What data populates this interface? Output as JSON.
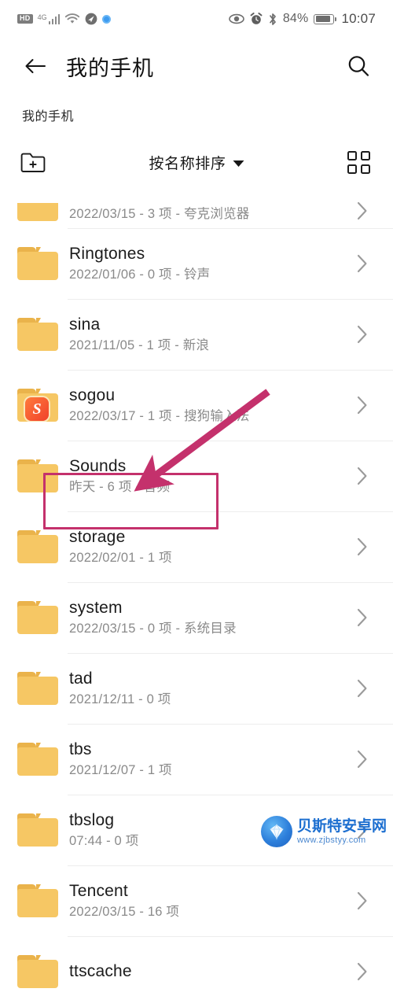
{
  "status_bar": {
    "hd_label": "HD",
    "network_label": "4G",
    "icons": [
      "hd-badge",
      "signal-bars",
      "wifi-icon",
      "location-icon",
      "blue-dot-icon"
    ],
    "right_icons": [
      "eye-icon",
      "alarm-icon",
      "bluetooth-icon"
    ],
    "battery_percent": "84%",
    "time": "10:07"
  },
  "header": {
    "title": "我的手机",
    "back_icon": "back-arrow-icon",
    "search_icon": "search-icon"
  },
  "breadcrumb": {
    "path": "我的手机"
  },
  "toolbar": {
    "new_folder_icon": "new-folder-icon",
    "sort_label": "按名称排序",
    "sort_caret": "chevron-down-icon",
    "grid_view_icon": "grid-view-icon"
  },
  "file_list": [
    {
      "name": "",
      "subtitle": "2022/03/15 - 3 项 - 夸克浏览器",
      "clipped": true,
      "badge": null
    },
    {
      "name": "Ringtones",
      "subtitle": "2022/01/06 - 0 项 - 铃声",
      "clipped": false,
      "badge": null
    },
    {
      "name": "sina",
      "subtitle": "2021/11/05 - 1 项 - 新浪",
      "clipped": false,
      "badge": null
    },
    {
      "name": "sogou",
      "subtitle": "2022/03/17 - 1 项 - 搜狗输入法",
      "clipped": false,
      "badge": "S"
    },
    {
      "name": "Sounds",
      "subtitle": "昨天 - 6 项 - 音频",
      "clipped": false,
      "badge": null
    },
    {
      "name": "storage",
      "subtitle": "2022/02/01 - 1 项",
      "clipped": false,
      "badge": null
    },
    {
      "name": "system",
      "subtitle": "2022/03/15 - 0 项 - 系统目录",
      "clipped": false,
      "badge": null
    },
    {
      "name": "tad",
      "subtitle": "2021/12/11 - 0 项",
      "clipped": false,
      "badge": null
    },
    {
      "name": "tbs",
      "subtitle": "2021/12/07 - 1 项",
      "clipped": false,
      "badge": null
    },
    {
      "name": "tbslog",
      "subtitle": "07:44 - 0 项",
      "clipped": false,
      "badge": null
    },
    {
      "name": "Tencent",
      "subtitle": "2022/03/15 - 16 项",
      "clipped": false,
      "badge": null
    },
    {
      "name": "ttscache",
      "subtitle": "",
      "clipped": false,
      "badge": null
    }
  ],
  "annotation": {
    "highlight_color": "#C4316C",
    "arrow_color": "#C4316C",
    "highlighted_item": "storage"
  },
  "watermark": {
    "site_name": "贝斯特安卓网",
    "url": "www.zjbstyy.com"
  },
  "colors": {
    "folder": "#F6C764",
    "folder_tab": "#EAB34B",
    "accent": "#C4316C"
  }
}
